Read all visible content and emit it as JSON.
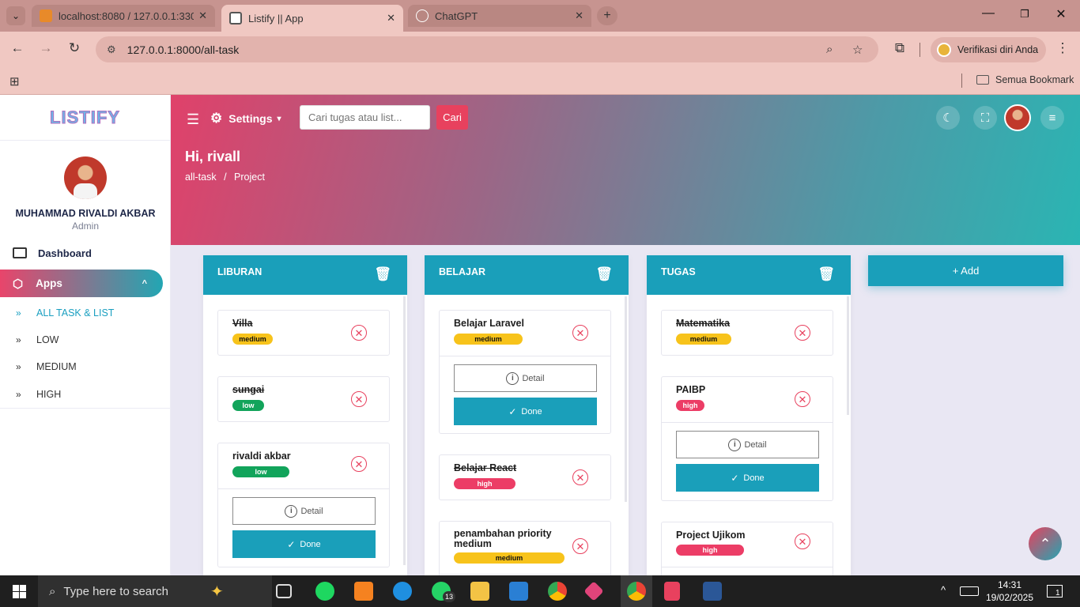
{
  "browser": {
    "tabs": [
      {
        "label": "localhost:8080 / 127.0.0.1:3307",
        "active": false
      },
      {
        "label": "Listify || App",
        "active": true
      },
      {
        "label": "ChatGPT",
        "active": false
      }
    ],
    "url": "127.0.0.1:8000/all-task",
    "profile_label": "Verifikasi diri Anda",
    "bookmarks_label": "Semua Bookmark"
  },
  "sidebar": {
    "logo": "LISTIFY",
    "user_name": "MUHAMMAD RIVALDI AKBAR",
    "user_role": "Admin",
    "dashboard": "Dashboard",
    "apps": "Apps",
    "subitems": [
      "ALL TASK & LIST",
      "LOW",
      "MEDIUM",
      "HIGH"
    ]
  },
  "header": {
    "settings": "Settings",
    "search_placeholder": "Cari tugas atau list...",
    "search_button": "Cari",
    "greeting": "Hi, rivall",
    "crumb1": "all-task",
    "crumb_sep": "/",
    "crumb2": "Project"
  },
  "board": {
    "add_label": "+ Add",
    "detail_label": "Detail",
    "done_label": "Done",
    "lists": [
      {
        "title": "LIBURAN",
        "tasks": [
          {
            "title": "Villa",
            "priority": "medium",
            "done": true
          },
          {
            "title": "sungai",
            "priority": "low",
            "done": true
          },
          {
            "title": "rivaldi akbar",
            "priority": "low",
            "done": false
          }
        ]
      },
      {
        "title": "BELAJAR",
        "tasks": [
          {
            "title": "Belajar Laravel",
            "priority": "medium",
            "done": false
          },
          {
            "title": "Belajar React",
            "priority": "high",
            "done": true
          },
          {
            "title": "penambahan priority medium",
            "priority": "medium",
            "done": false
          }
        ]
      },
      {
        "title": "TUGAS",
        "tasks": [
          {
            "title": "Matematika",
            "priority": "medium",
            "done": true
          },
          {
            "title": "PAIBP",
            "priority": "high",
            "done": false
          },
          {
            "title": "Project Ujikom",
            "priority": "high",
            "done": false
          }
        ]
      }
    ]
  },
  "taskbar": {
    "search_placeholder": "Type here to search",
    "time": "14:31",
    "date": "19/02/2025",
    "whatsapp_badge": "13",
    "notification_count": "1"
  },
  "colors": {
    "accent": "#1a9fba",
    "danger": "#e8415e",
    "medium": "#f7c31b",
    "low": "#12a45b",
    "high": "#ec3d66"
  }
}
